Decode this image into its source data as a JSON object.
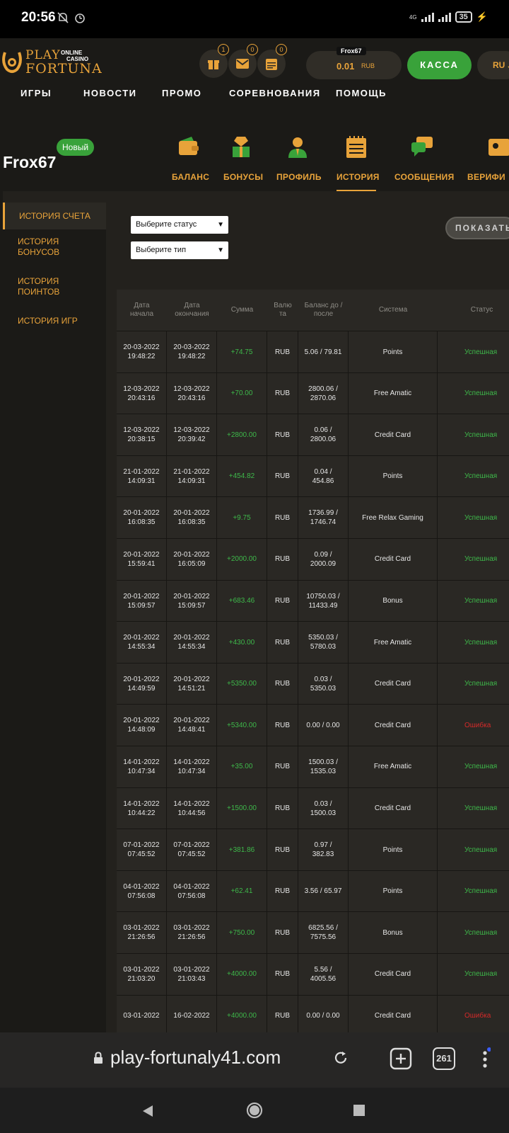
{
  "status_bar": {
    "time": "20:56",
    "network": "4G",
    "battery": "35"
  },
  "header": {
    "logo": {
      "play": "PLAY",
      "online": "ONLINE",
      "casino": "CASINO",
      "fortuna": "FORTUNA"
    },
    "badges": {
      "gift": "1",
      "mail": "0",
      "calendar": "0"
    },
    "username": "Frox67",
    "balance": "0.01",
    "currency": "RUB",
    "kassa": "КАССА",
    "lang": "RU"
  },
  "nav": [
    "ИГРЫ",
    "НОВОСТИ",
    "ПРОМО",
    "СОРЕВНОВАНИЯ",
    "ПОМОЩЬ"
  ],
  "profile": {
    "new_badge": "Новый",
    "name": "Frox67",
    "tabs": [
      "БАЛАНС",
      "БОНУСЫ",
      "ПРОФИЛЬ",
      "ИСТОРИЯ",
      "СООБЩЕНИЯ",
      "ВЕРИФИ"
    ]
  },
  "sidemenu": [
    "ИСТОРИЯ СЧЕТА",
    "ИСТОРИЯ\nБОНУСОВ",
    "ИСТОРИЯ\nПОИНТОВ",
    "ИСТОРИЯ ИГР"
  ],
  "filters": {
    "status": "Выберите статус",
    "type": "Выберите тип",
    "show": "ПОКАЗАТЬ"
  },
  "table": {
    "headers": [
      "Дата\nначала",
      "Дата\nокончания",
      "Сумма",
      "Валю\nта",
      "Баланс до /\nпосле",
      "Система",
      "Статус"
    ],
    "rows": [
      [
        "20-03-2022\n19:48:22",
        "20-03-2022\n19:48:22",
        "+74.75",
        "RUB",
        "5.06 / 79.81",
        "Points",
        "Успешная"
      ],
      [
        "12-03-2022\n20:43:16",
        "12-03-2022\n20:43:16",
        "+70.00",
        "RUB",
        "2800.06 /\n2870.06",
        "Free Amatic",
        "Успешная"
      ],
      [
        "12-03-2022\n20:38:15",
        "12-03-2022\n20:39:42",
        "+2800.00",
        "RUB",
        "0.06 /\n2800.06",
        "Credit Card",
        "Успешная"
      ],
      [
        "21-01-2022\n14:09:31",
        "21-01-2022\n14:09:31",
        "+454.82",
        "RUB",
        "0.04 /\n454.86",
        "Points",
        "Успешная"
      ],
      [
        "20-01-2022\n16:08:35",
        "20-01-2022\n16:08:35",
        "+9.75",
        "RUB",
        "1736.99 /\n1746.74",
        "Free Relax Gaming",
        "Успешная"
      ],
      [
        "20-01-2022\n15:59:41",
        "20-01-2022\n16:05:09",
        "+2000.00",
        "RUB",
        "0.09 /\n2000.09",
        "Credit Card",
        "Успешная"
      ],
      [
        "20-01-2022\n15:09:57",
        "20-01-2022\n15:09:57",
        "+683.46",
        "RUB",
        "10750.03 /\n11433.49",
        "Bonus",
        "Успешная"
      ],
      [
        "20-01-2022\n14:55:34",
        "20-01-2022\n14:55:34",
        "+430.00",
        "RUB",
        "5350.03 /\n5780.03",
        "Free Amatic",
        "Успешная"
      ],
      [
        "20-01-2022\n14:49:59",
        "20-01-2022\n14:51:21",
        "+5350.00",
        "RUB",
        "0.03 /\n5350.03",
        "Credit Card",
        "Успешная"
      ],
      [
        "20-01-2022\n14:48:09",
        "20-01-2022\n14:48:41",
        "+5340.00",
        "RUB",
        "0.00 / 0.00",
        "Credit Card",
        "Ошибка"
      ],
      [
        "14-01-2022\n10:47:34",
        "14-01-2022\n10:47:34",
        "+35.00",
        "RUB",
        "1500.03 /\n1535.03",
        "Free Amatic",
        "Успешная"
      ],
      [
        "14-01-2022\n10:44:22",
        "14-01-2022\n10:44:56",
        "+1500.00",
        "RUB",
        "0.03 /\n1500.03",
        "Credit Card",
        "Успешная"
      ],
      [
        "07-01-2022\n07:45:52",
        "07-01-2022\n07:45:52",
        "+381.86",
        "RUB",
        "0.97 /\n382.83",
        "Points",
        "Успешная"
      ],
      [
        "04-01-2022\n07:56:08",
        "04-01-2022\n07:56:08",
        "+62.41",
        "RUB",
        "3.56 / 65.97",
        "Points",
        "Успешная"
      ],
      [
        "03-01-2022\n21:26:56",
        "03-01-2022\n21:26:56",
        "+750.00",
        "RUB",
        "6825.56 /\n7575.56",
        "Bonus",
        "Успешная"
      ],
      [
        "03-01-2022\n21:03:20",
        "03-01-2022\n21:03:43",
        "+4000.00",
        "RUB",
        "5.56 /\n4005.56",
        "Credit Card",
        "Успешная"
      ],
      [
        "03-01-2022",
        "16-02-2022",
        "+4000.00",
        "RUB",
        "0.00 / 0.00",
        "Credit Card",
        "Ошибка"
      ]
    ]
  },
  "browser": {
    "url": "play-fortunaly41.com",
    "tabs": "261"
  },
  "colors": {
    "accent": "#e8a33a",
    "green": "#39a23a",
    "success": "#3eb84a",
    "error": "#d52a2a"
  }
}
